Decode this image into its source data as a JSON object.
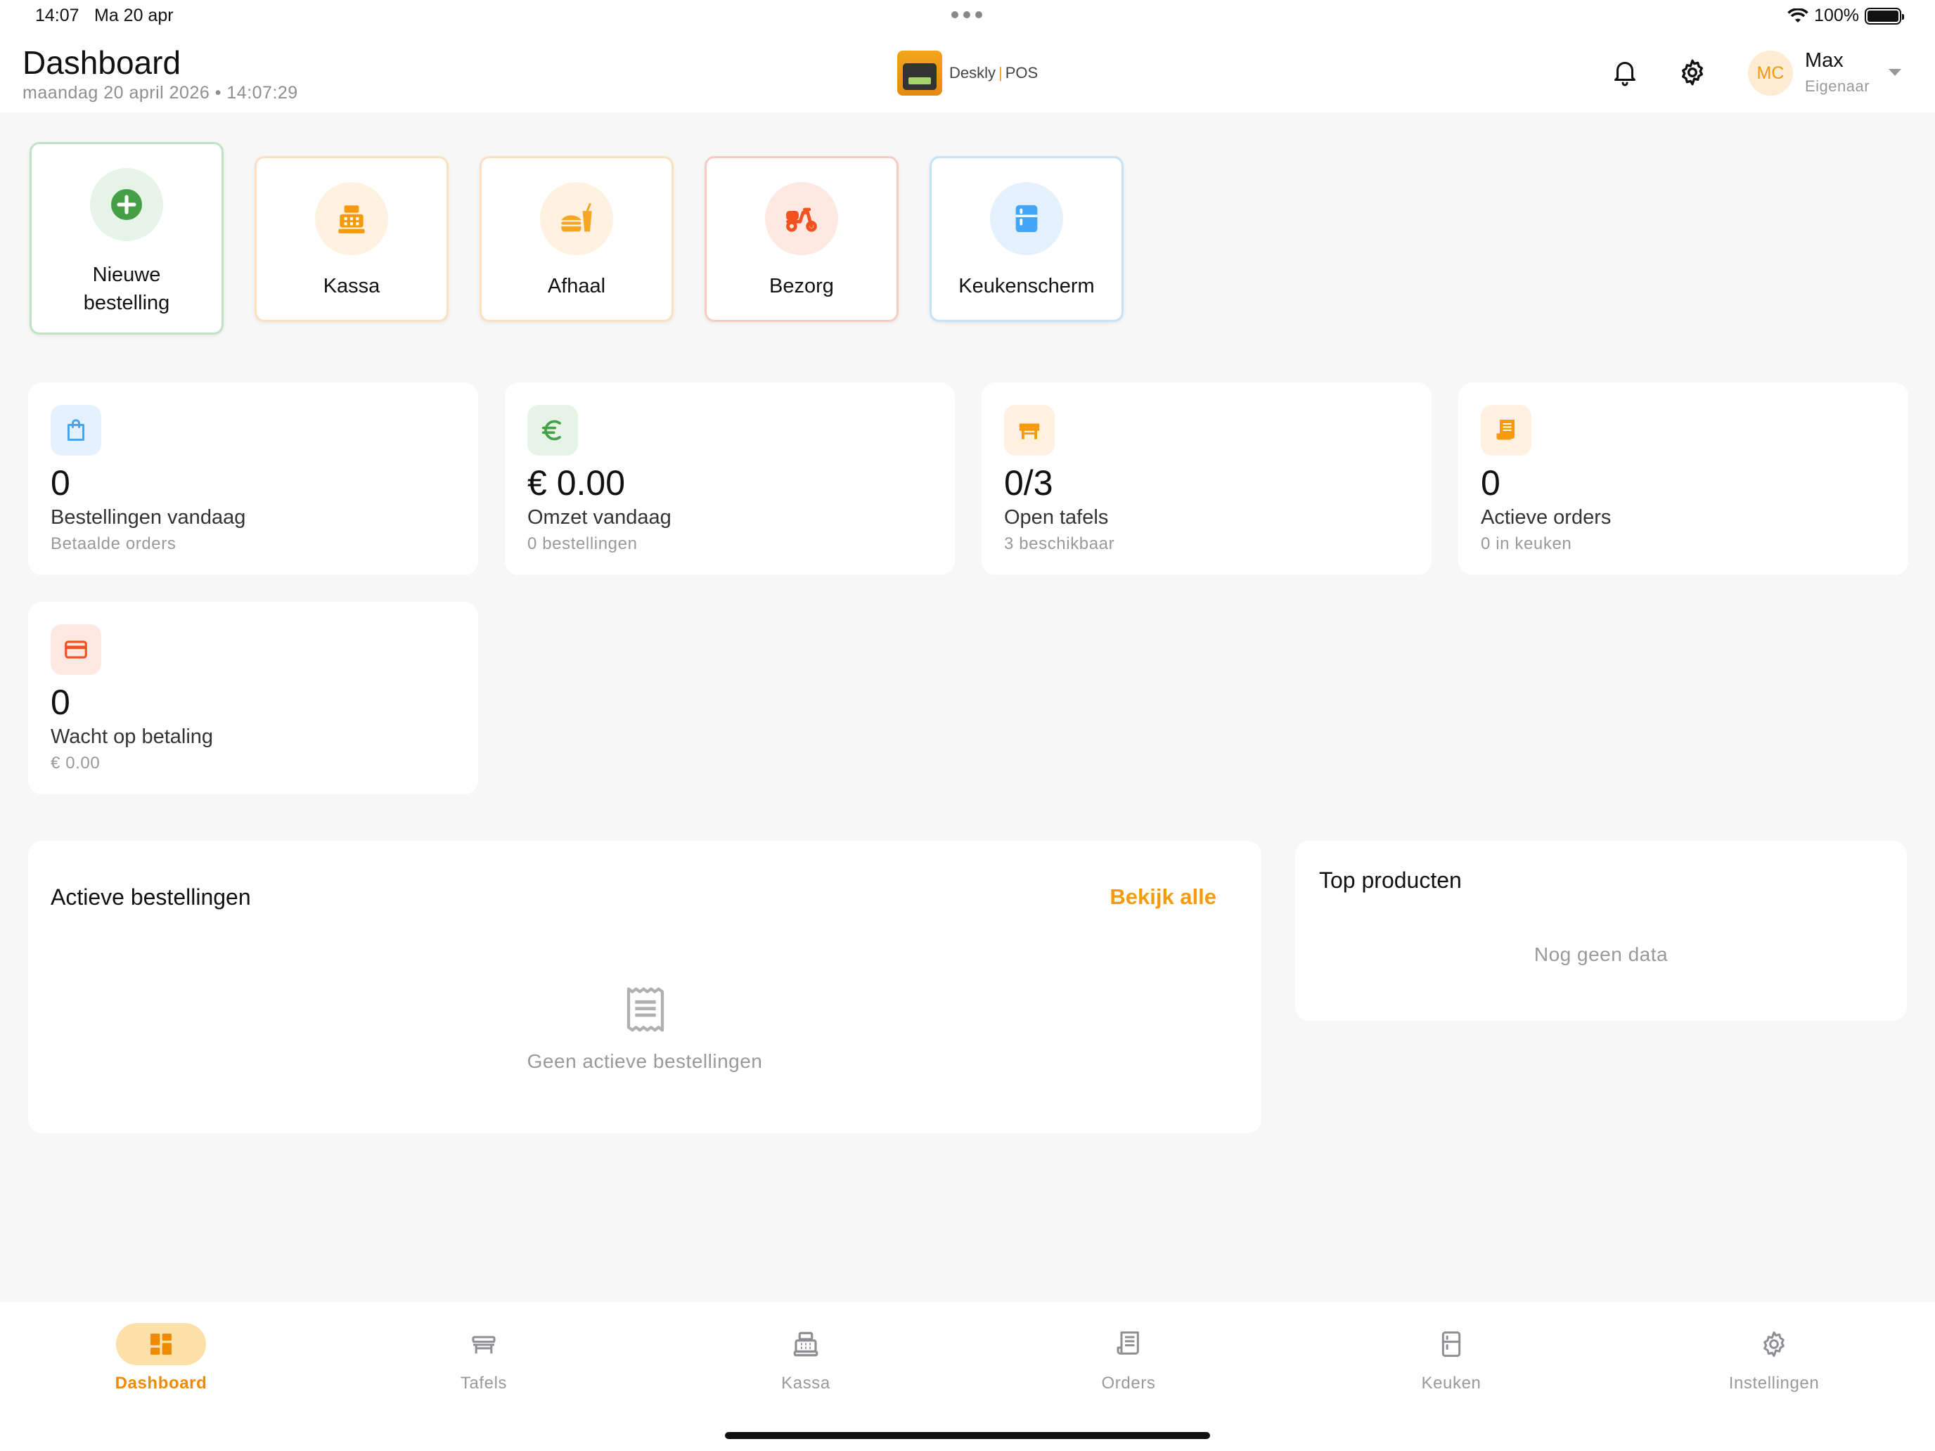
{
  "status_bar": {
    "time": "14:07",
    "date": "Ma 20 apr",
    "battery": "100%"
  },
  "header": {
    "title": "Dashboard",
    "subtitle": "maandag 20 april 2026 • 14:07:29",
    "logo": {
      "brand": "Deskly",
      "separator": "|",
      "product": "POS"
    },
    "user": {
      "initials": "MC",
      "name": "Max",
      "role": "Eigenaar"
    }
  },
  "quick_actions": [
    {
      "label": "Nieuwe bestelling",
      "icon": "plus-circle-icon",
      "color": "#43a047"
    },
    {
      "label": "Kassa",
      "icon": "cash-register-icon",
      "color": "#f59b0b"
    },
    {
      "label": "Afhaal",
      "icon": "takeaway-food-icon",
      "color": "#f5a623"
    },
    {
      "label": "Bezorg",
      "icon": "scooter-icon",
      "color": "#f4511e"
    },
    {
      "label": "Keukenscherm",
      "icon": "fridge-icon",
      "color": "#42a5f5"
    }
  ],
  "stats": [
    {
      "value": "0",
      "label": "Bestellingen vandaag",
      "sub": "Betaalde orders",
      "icon": "shopping-bag-icon",
      "color": "#42a5f5"
    },
    {
      "value": "€ 0.00",
      "label": "Omzet vandaag",
      "sub": "0 bestellingen",
      "icon": "euro-icon",
      "color": "#43a047"
    },
    {
      "value": "0/3",
      "label": "Open tafels",
      "sub": "3 beschikbaar",
      "icon": "table-icon",
      "color": "#f59b0b"
    },
    {
      "value": "0",
      "label": "Actieve orders",
      "sub": "0 in keuken",
      "icon": "receipt-icon",
      "color": "#f59b0b"
    },
    {
      "value": "0",
      "label": "Wacht op betaling",
      "sub": "€ 0.00",
      "icon": "credit-card-icon",
      "color": "#f4511e"
    }
  ],
  "active_orders": {
    "title": "Actieve bestellingen",
    "view_all": "Bekijk alle",
    "empty": "Geen actieve bestellingen"
  },
  "top_products": {
    "title": "Top producten",
    "empty": "Nog geen data"
  },
  "bottom_nav": [
    {
      "label": "Dashboard",
      "icon": "dashboard-icon",
      "active": true
    },
    {
      "label": "Tafels",
      "icon": "table-icon",
      "active": false
    },
    {
      "label": "Kassa",
      "icon": "cash-register-icon",
      "active": false
    },
    {
      "label": "Orders",
      "icon": "receipt-icon",
      "active": false
    },
    {
      "label": "Keuken",
      "icon": "fridge-icon",
      "active": false
    },
    {
      "label": "Instellingen",
      "icon": "gear-icon",
      "active": false
    }
  ],
  "colors": {
    "accent": "#f59b0b",
    "background": "#f7f7f7",
    "card": "#ffffff"
  }
}
